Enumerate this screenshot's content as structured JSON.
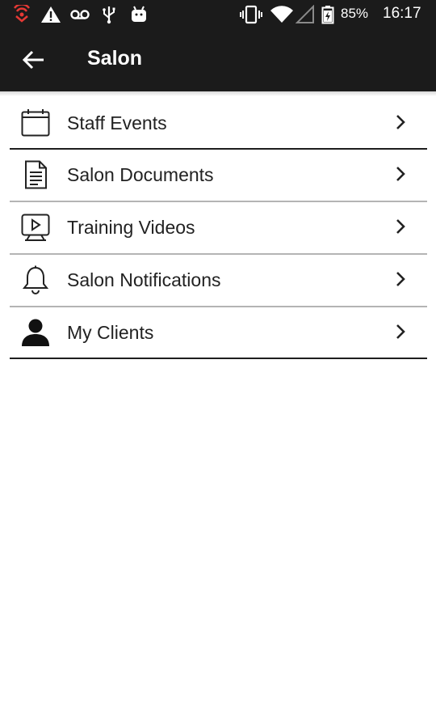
{
  "status_bar": {
    "battery_percent": "85%",
    "time": "16:17",
    "icons": [
      "cast-icon",
      "warning-icon",
      "voicemail-icon",
      "usb-icon",
      "android-icon",
      "vibrate-icon",
      "wifi-icon",
      "signal-icon",
      "battery-icon"
    ],
    "accent_color": "#e53935"
  },
  "app_bar": {
    "title": "Salon",
    "back_icon": "arrow-left-icon",
    "background": "#1b1b1b"
  },
  "menu": {
    "items": [
      {
        "label": "Staff Events",
        "icon": "calendar-icon"
      },
      {
        "label": "Salon Documents",
        "icon": "document-icon"
      },
      {
        "label": "Training Videos",
        "icon": "video-icon"
      },
      {
        "label": "Salon Notifications",
        "icon": "bell-icon"
      },
      {
        "label": "My Clients",
        "icon": "person-icon"
      }
    ],
    "chevron_icon": "chevron-right-icon"
  }
}
